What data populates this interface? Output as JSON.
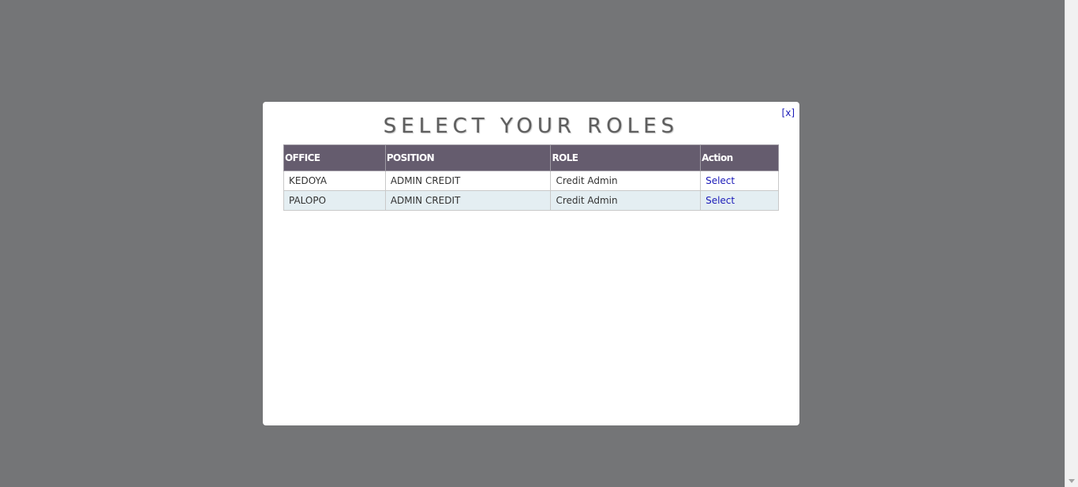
{
  "modal": {
    "close_label": "[x]",
    "title": "SELECT YOUR ROLES"
  },
  "table": {
    "headers": [
      "OFFICE",
      "POSITION",
      "ROLE",
      "Action"
    ],
    "rows": [
      {
        "office": "KEDOYA",
        "position": "ADMIN CREDIT",
        "role": "Credit Admin",
        "action": "Select"
      },
      {
        "office": "PALOPO",
        "position": "ADMIN CREDIT",
        "role": "Credit Admin",
        "action": "Select"
      }
    ]
  },
  "colors": {
    "overlay": "#747577",
    "header_bg": "#655c6e",
    "row_alt_bg": "#e4eef2",
    "link": "#1a1ab8"
  }
}
